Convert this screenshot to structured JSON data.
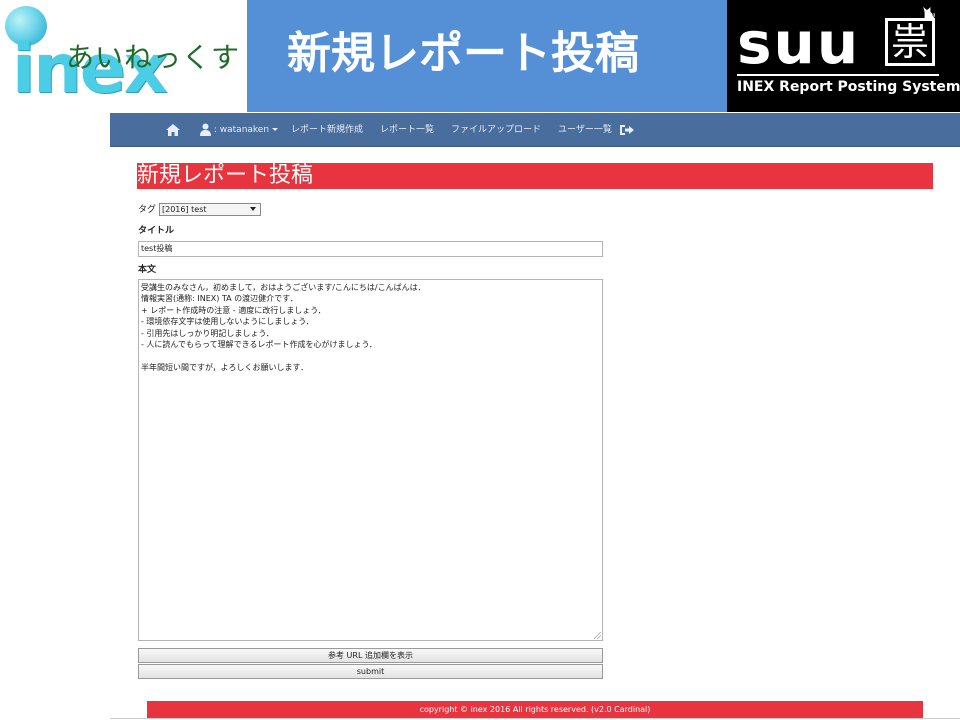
{
  "slide": {
    "logo_word": "inex",
    "logo_kana": "あいねっくす",
    "title": "新規レポート投稿",
    "suu_word": "suu",
    "suu_kanji": "祟",
    "suu_subtitle": "INEX Report Posting System"
  },
  "colors": {
    "slide_title_bg": "#5590d6",
    "navbar_bg": "#496d9c",
    "accent_red": "#e8343e"
  },
  "navbar": {
    "home_icon": "home-icon",
    "user_icon": "user-icon",
    "user_label": ": watanaken",
    "new_report": "レポート新規作成",
    "report_list": "レポート一覧",
    "file_upload": "ファイルアップロード",
    "user_list": "ユーザー一覧",
    "logout_icon": "sign-out-icon"
  },
  "form": {
    "heading": "新規レポート投稿",
    "tag_label": "タグ",
    "tag_selected": "[2016] test",
    "title_label": "タイトル",
    "title_value": "test投稿",
    "body_label": "本文",
    "body_lines": [
      "受講生のみなさん，初めまして，おはようございます/こんにちは/こんばんは．",
      "情報実習(通称: INEX) TA の渡辺健介です．",
      "+ レポート作成時の注意 - 適度に改行しましょう．",
      "  - 環境依存文字は使用しないようにしましょう．",
      " - 引用先はしっかり明記しましょう．",
      "  - 人に読んでもらって理解できるレポート作成を心がけましょう．",
      "",
      "半年間短い間ですが，よろしくお願いします．"
    ],
    "ref_url_button": "参考 URL 追加欄を表示",
    "submit_button": "submit"
  },
  "footer": {
    "text": "copyright © inex 2016 All rights reserved. (v2.0 Cardinal)"
  }
}
